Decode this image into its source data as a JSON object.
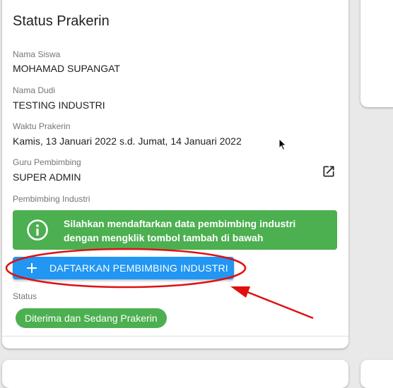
{
  "title": "Status Prakerin",
  "fields": [
    {
      "label": "Nama Siswa",
      "value": "MOHAMAD SUPANGAT"
    },
    {
      "label": "Nama Dudi",
      "value": "TESTING INDUSTRI"
    },
    {
      "label": "Waktu Prakerin",
      "value": "Kamis, 13 Januari 2022 s.d. Jumat, 14 Januari 2022"
    },
    {
      "label": "Guru Pembimbing",
      "value": "SUPER ADMIN"
    }
  ],
  "pembimbing_industri": {
    "label": "Pembimbing Industri",
    "alert_line1": "Silahkan mendaftarkan data pembimbing industri",
    "alert_line2": "dengan mengklik tombol tambah di bawah",
    "button_label": "DAFTARKAN PEMBIMBING INDUSTRI"
  },
  "status": {
    "label": "Status",
    "chip": "Diterima dan Sedang Prakerin"
  },
  "colors": {
    "success": "#4caf50",
    "primary": "#2196f3",
    "annotation": "#e01010"
  },
  "icons": {
    "open_in_new": "open-in-new-icon",
    "info": "info-icon",
    "plus": "plus-icon",
    "cursor": "mouse-cursor-icon"
  }
}
